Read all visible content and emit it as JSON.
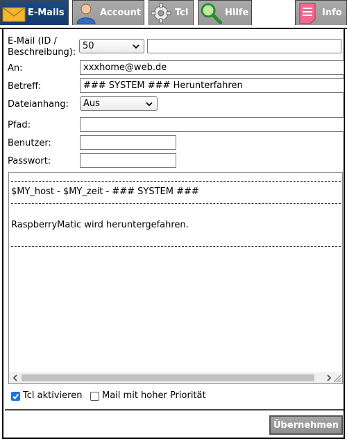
{
  "tabs": {
    "emails": "E-Mails",
    "account": "Account",
    "tcl": "Tcl",
    "hilfe": "Hilfe",
    "info": "Info"
  },
  "form": {
    "email_id_label": "E-Mail (ID /",
    "email_id_label2": "Beschreibung):",
    "email_id_value": "50",
    "email_desc_value": "",
    "an_label": "An:",
    "an_value": "xxxhome@web.de",
    "betreff_label": "Betreff:",
    "betreff_value": "### SYSTEM ### Herunterfahren",
    "dateianhang_label": "Dateianhang:",
    "dateianhang_value": "Aus",
    "pfad_label": "Pfad:",
    "pfad_value": "",
    "benutzer_label": "Benutzer:",
    "benutzer_value": "",
    "passwort_label": "Passwort:",
    "passwort_value": ""
  },
  "message": {
    "line1": "$MY_host - $MY_zeit - ### SYSTEM ###",
    "line2": "RaspberryMatic wird heruntergefahren."
  },
  "options": {
    "tcl_label": "Tcl aktivieren",
    "tcl_checked": true,
    "prio_label": "Mail mit hoher Priorität",
    "prio_checked": false
  },
  "buttons": {
    "submit": "Übernehmen"
  },
  "colors": {
    "active_tab": "#1b4a86",
    "inactive_tab": "#a0a0a0",
    "checkbox_accent": "#1a73e8"
  }
}
